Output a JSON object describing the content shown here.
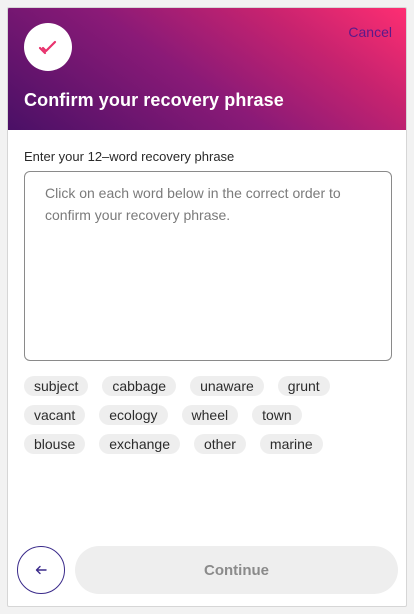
{
  "header": {
    "title": "Confirm your recovery phrase",
    "cancel_label": "Cancel",
    "logo_icon": "check-icon",
    "logo_color": "#e8336d"
  },
  "form": {
    "label": "Enter your 12–word recovery phrase",
    "placeholder": "Click on each word below in the correct order to confirm your recovery phrase.",
    "value": ""
  },
  "words": [
    [
      "subject",
      "cabbage",
      "unaware",
      "grunt"
    ],
    [
      "vacant",
      "ecology",
      "wheel",
      "town"
    ],
    [
      "blouse",
      "exchange",
      "other",
      "marine"
    ]
  ],
  "footer": {
    "back_icon": "arrow-left-icon",
    "continue_label": "Continue",
    "continue_enabled": false
  },
  "colors": {
    "gradient_start": "#4a1066",
    "gradient_end": "#ff2e72",
    "accent": "#3a2a8a"
  }
}
